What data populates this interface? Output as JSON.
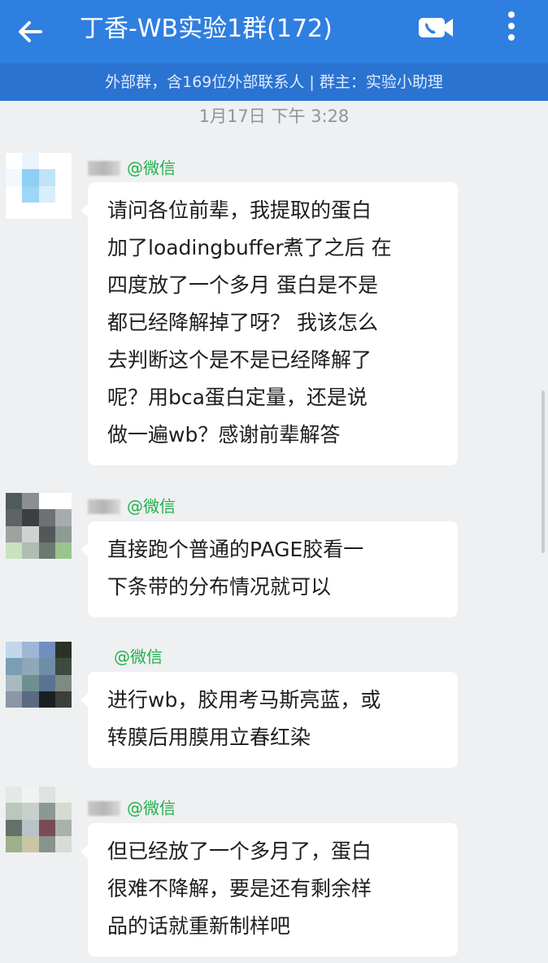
{
  "header": {
    "title": "丁香-WB实验1群(172)",
    "subtitle": "外部群，含169位外部联系人 | 群主：实验小助理",
    "back_icon": "arrow-left-icon",
    "call_icon": "video-call-icon",
    "more_icon": "more-vertical-icon"
  },
  "timestamp": "1月17日  下午 3:28",
  "sender_tag": "@微信",
  "messages": [
    {
      "lines": [
        "请问各位前辈，我提取的蛋白",
        "加了loadingbuffer煮了之后 在",
        "四度放了一个多月 蛋白是不是",
        "都已经降解掉了呀？ 我该怎么",
        "去判断这个是不是已经降解了",
        "呢？用bca蛋白定量，还是说",
        "做一遍wb？感谢前辈解答"
      ]
    },
    {
      "lines": [
        "直接跑个普通的PAGE胶看一",
        "下条带的分布情况就可以"
      ]
    },
    {
      "lines": [
        "进行wb，胶用考马斯亮蓝，或",
        "转膜后用膜用立春红染"
      ]
    },
    {
      "lines": [
        "但已经放了一个多月了，蛋白",
        "很难不降解，要是还有剩余样",
        "品的话就重新制样吧"
      ]
    }
  ],
  "colors": {
    "header_bg": "#2f7fe0",
    "subbar_bg": "#2a73d1",
    "wechat_tag": "#21b14a",
    "chat_bg": "#eef0f2"
  }
}
